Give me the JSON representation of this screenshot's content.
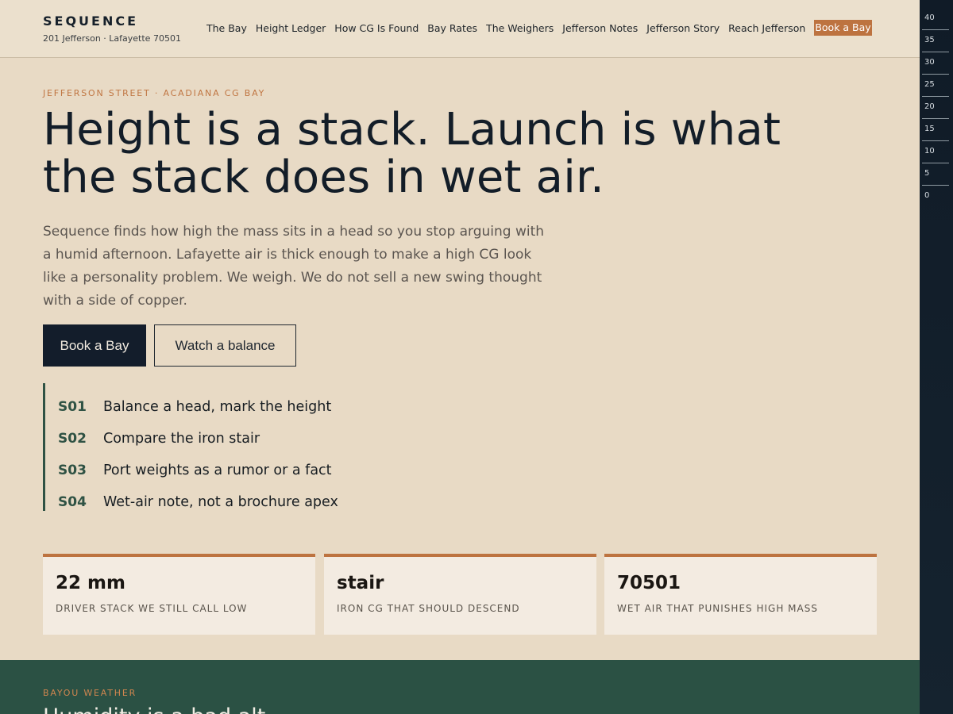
{
  "header": {
    "brand_name": "SEQUENCE",
    "brand_address": "201 Jefferson · Lafayette 70501",
    "nav": [
      "The Bay",
      "Height Ledger",
      "How CG Is Found",
      "Bay Rates",
      "The Weighers",
      "Jefferson Notes",
      "Jefferson Story",
      "Reach Jefferson"
    ],
    "cta_label": "Book a Bay"
  },
  "hero": {
    "eyebrow": "JEFFERSON STREET · ACADIANA CG BAY",
    "title": "Height is a stack. Launch is what the stack does in wet air.",
    "lead": "Sequence finds how high the mass sits in a head so you stop arguing with a humid afternoon. Lafayette air is thick enough to make a high CG look like a personality problem. We weigh. We do not sell a new swing thought with a side of copper.",
    "primary_button": "Book a Bay",
    "secondary_button": "Watch a balance"
  },
  "steps": [
    {
      "code": "S01",
      "text": "Balance a head, mark the height"
    },
    {
      "code": "S02",
      "text": "Compare the iron stair"
    },
    {
      "code": "S03",
      "text": "Port weights as a rumor or a fact"
    },
    {
      "code": "S04",
      "text": "Wet-air note, not a brochure apex"
    }
  ],
  "stats": [
    {
      "value": "22 mm",
      "label": "DRIVER STACK WE STILL CALL LOW"
    },
    {
      "value": "stair",
      "label": "IRON CG THAT SHOULD DESCEND"
    },
    {
      "value": "70501",
      "label": "WET AIR THAT PUNISHES HIGH MASS"
    }
  ],
  "weather": {
    "eyebrow": "BAYOU WEATHER",
    "title": "Humidity is a bad alt"
  },
  "height_rail": {
    "ticks": [
      "40",
      "35",
      "30",
      "25",
      "20",
      "15",
      "10",
      "5",
      "0"
    ]
  },
  "colors": {
    "accent": "#bd7340",
    "navy": "#131d2b",
    "green": "#2b5144",
    "background": "#e8dac5"
  }
}
